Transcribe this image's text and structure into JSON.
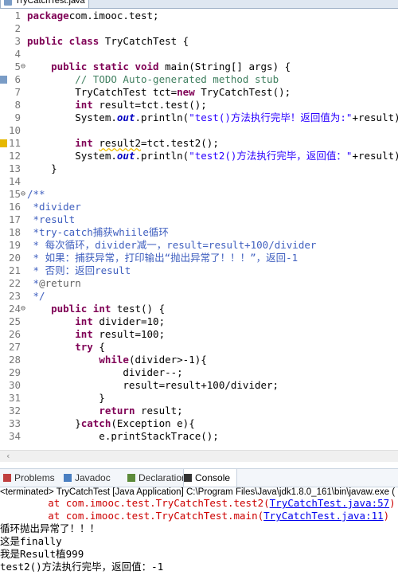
{
  "editor_tab": {
    "title": "TryCatchTest.java",
    "close": "✕"
  },
  "code_lines": [
    {
      "n": "1",
      "mark": "",
      "segs": [
        [
          "kw",
          "package"
        ],
        [
          "",
          "com.imooc.test;"
        ]
      ]
    },
    {
      "n": "2",
      "mark": "",
      "segs": []
    },
    {
      "n": "3",
      "mark": "",
      "segs": [
        [
          "kw",
          "public class"
        ],
        [
          "",
          " TryCatchTest {"
        ]
      ]
    },
    {
      "n": "4",
      "mark": "",
      "segs": []
    },
    {
      "n": "5",
      "mark": "⊖",
      "segs": [
        [
          "",
          "    "
        ],
        [
          "kw",
          "public static void"
        ],
        [
          "",
          " main(String[] args) {"
        ]
      ]
    },
    {
      "n": "6",
      "mark": "",
      "segs": [
        [
          "",
          "        "
        ],
        [
          "cm",
          "// TODO Auto-generated method stub"
        ]
      ]
    },
    {
      "n": "7",
      "mark": "",
      "segs": [
        [
          "",
          "        TryCatchTest tct="
        ],
        [
          "kw",
          "new"
        ],
        [
          "",
          " TryCatchTest();"
        ]
      ]
    },
    {
      "n": "8",
      "mark": "",
      "segs": [
        [
          "",
          "        "
        ],
        [
          "kw",
          "int"
        ],
        [
          "",
          " result=tct.test();"
        ]
      ]
    },
    {
      "n": "9",
      "mark": "",
      "segs": [
        [
          "",
          "        System."
        ],
        [
          "fld",
          "out"
        ],
        [
          "",
          ".println("
        ],
        [
          "str",
          "\"test()方法执行完毕！返回值为:\""
        ],
        [
          "",
          "+result);"
        ]
      ]
    },
    {
      "n": "10",
      "mark": "",
      "segs": []
    },
    {
      "n": "11",
      "mark": "",
      "segs": [
        [
          "",
          "        "
        ],
        [
          "kw",
          "int"
        ],
        [
          "",
          " "
        ],
        [
          "sq",
          "result2"
        ],
        [
          "",
          "=tct.test2();"
        ]
      ]
    },
    {
      "n": "12",
      "mark": "",
      "segs": [
        [
          "",
          "        System."
        ],
        [
          "fld",
          "out"
        ],
        [
          "",
          ".println("
        ],
        [
          "str",
          "\"test2()方法执行完毕，返回值：\""
        ],
        [
          "",
          "+result);"
        ]
      ]
    },
    {
      "n": "13",
      "mark": "",
      "segs": [
        [
          "",
          "    }"
        ]
      ]
    },
    {
      "n": "14",
      "mark": "",
      "segs": []
    },
    {
      "n": "15",
      "mark": "⊖",
      "segs": [
        [
          "jd",
          "/**"
        ]
      ]
    },
    {
      "n": "16",
      "mark": "",
      "segs": [
        [
          "jd",
          " *divider"
        ]
      ]
    },
    {
      "n": "17",
      "mark": "",
      "segs": [
        [
          "jd",
          " *result"
        ]
      ]
    },
    {
      "n": "18",
      "mark": "",
      "segs": [
        [
          "jd",
          " *try-catch捕获whiile循环"
        ]
      ]
    },
    {
      "n": "19",
      "mark": "",
      "segs": [
        [
          "jd",
          " * 每次循环，divider减一，result=result+100/divider"
        ]
      ]
    },
    {
      "n": "20",
      "mark": "",
      "segs": [
        [
          "jd",
          " * 如果：捕获异常，打印输出“抛出异常了！！！”，返回-1"
        ]
      ]
    },
    {
      "n": "21",
      "mark": "",
      "segs": [
        [
          "jd",
          " * 否则：返回result"
        ]
      ]
    },
    {
      "n": "22",
      "mark": "",
      "segs": [
        [
          "jd",
          " *"
        ],
        [
          "ann",
          "@return"
        ]
      ]
    },
    {
      "n": "23",
      "mark": "",
      "segs": [
        [
          "jd",
          " */"
        ]
      ]
    },
    {
      "n": "24",
      "mark": "⊖",
      "segs": [
        [
          "",
          "    "
        ],
        [
          "kw",
          "public int"
        ],
        [
          "",
          " test() {"
        ]
      ]
    },
    {
      "n": "25",
      "mark": "",
      "segs": [
        [
          "",
          "        "
        ],
        [
          "kw",
          "int"
        ],
        [
          "",
          " divider=10;"
        ]
      ]
    },
    {
      "n": "26",
      "mark": "",
      "segs": [
        [
          "",
          "        "
        ],
        [
          "kw",
          "int"
        ],
        [
          "",
          " result=100;"
        ]
      ]
    },
    {
      "n": "27",
      "mark": "",
      "segs": [
        [
          "",
          "        "
        ],
        [
          "kw",
          "try"
        ],
        [
          "",
          " {"
        ]
      ]
    },
    {
      "n": "28",
      "mark": "",
      "segs": [
        [
          "",
          "            "
        ],
        [
          "kw",
          "while"
        ],
        [
          "",
          "(divider>-1){"
        ]
      ]
    },
    {
      "n": "29",
      "mark": "",
      "segs": [
        [
          "",
          "                divider--;"
        ]
      ]
    },
    {
      "n": "30",
      "mark": "",
      "segs": [
        [
          "",
          "                result=result+100/divider;"
        ]
      ]
    },
    {
      "n": "31",
      "mark": "",
      "segs": [
        [
          "",
          "            }"
        ]
      ]
    },
    {
      "n": "32",
      "mark": "",
      "segs": [
        [
          "",
          "            "
        ],
        [
          "kw",
          "return"
        ],
        [
          "",
          " result;"
        ]
      ]
    },
    {
      "n": "33",
      "mark": "",
      "segs": [
        [
          "",
          "        }"
        ],
        [
          "kw",
          "catch"
        ],
        [
          "",
          "(Exception e){"
        ]
      ]
    },
    {
      "n": "34",
      "mark": "",
      "segs": [
        [
          "",
          "            e.printStackTrace();"
        ]
      ]
    }
  ],
  "view_tabs": [
    "Problems",
    "Javadoc",
    "Declaration",
    "Console"
  ],
  "view_tab_icons": [
    "problems-icon",
    "javadoc-icon",
    "declaration-icon",
    "console-icon"
  ],
  "console_header": "<terminated> TryCatchTest [Java Application] C:\\Program Files\\Java\\jdk1.8.0_161\\bin\\javaw.exe (",
  "console_lines": [
    {
      "segs": [
        [
          "err",
          "        at com.imooc.test.TryCatchTest.test2("
        ],
        [
          "link",
          "TryCatchTest.java:57"
        ],
        [
          "err",
          ")"
        ]
      ]
    },
    {
      "segs": [
        [
          "err",
          "        at com.imooc.test.TryCatchTest.main("
        ],
        [
          "link",
          "TryCatchTest.java:11"
        ],
        [
          "err",
          ")"
        ]
      ]
    },
    {
      "segs": [
        [
          "",
          "循环抛出异常了！！！"
        ]
      ]
    },
    {
      "segs": [
        [
          "",
          "这是finally"
        ]
      ]
    },
    {
      "segs": [
        [
          "",
          "我是Result植999"
        ]
      ]
    },
    {
      "segs": [
        [
          "",
          "test2()方法执行完毕，返回值：-1"
        ]
      ]
    }
  ],
  "colors": {
    "keyword": "#7f0055",
    "comment": "#3f7f5f",
    "javadoc": "#3f5fbf",
    "string": "#2a00ff",
    "error": "#cc0000"
  }
}
